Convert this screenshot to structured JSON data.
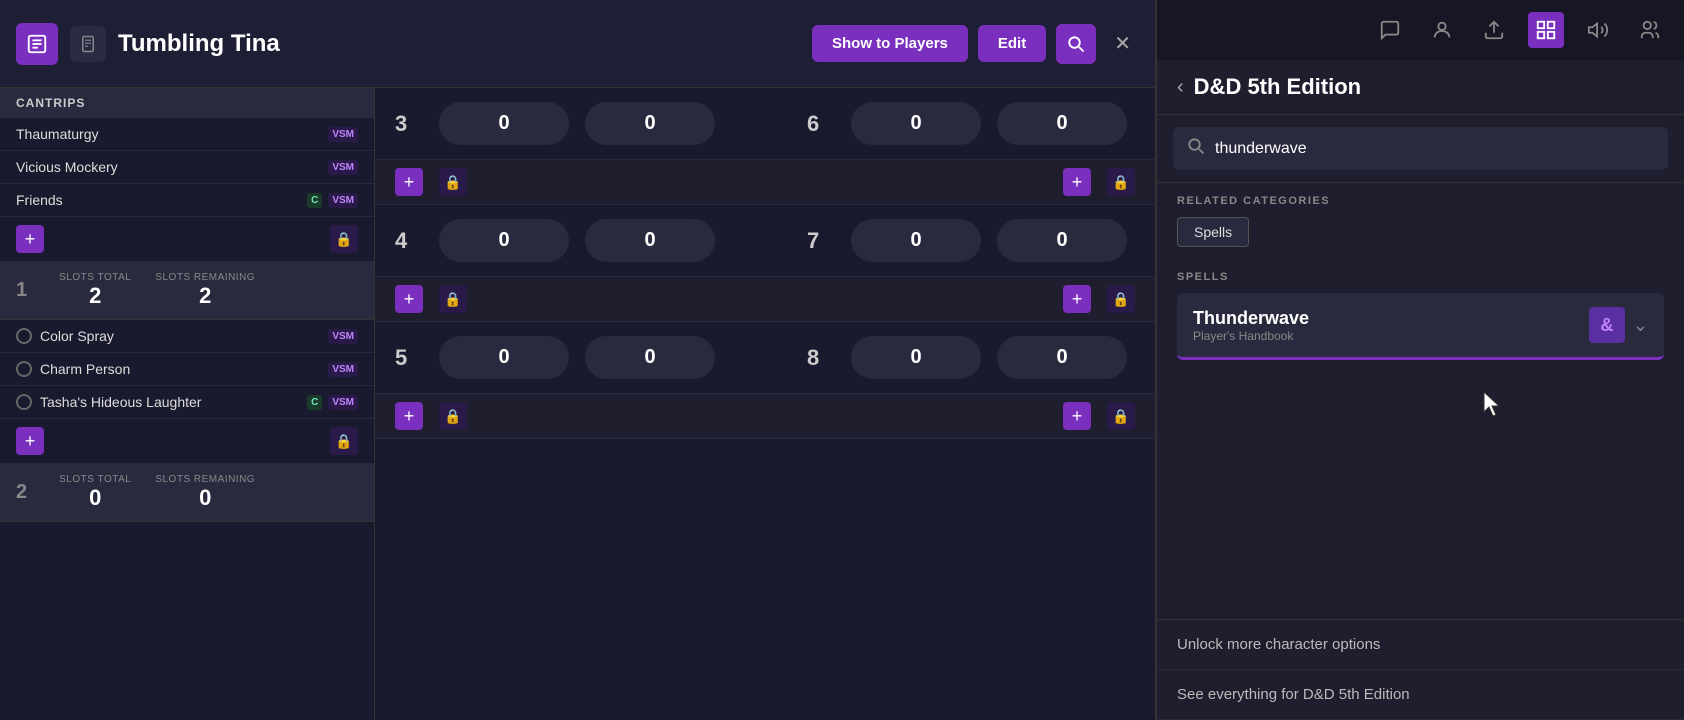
{
  "header": {
    "title": "Tumbling Tina",
    "show_players_label": "Show to Players",
    "edit_label": "Edit"
  },
  "spell_list": {
    "cantrips_label": "CANTRIPS",
    "spells": [
      {
        "name": "Thaumaturgy",
        "tags": [
          "VSM"
        ],
        "has_circle": false
      },
      {
        "name": "Vicious Mockery",
        "tags": [
          "VSM"
        ],
        "has_circle": false
      },
      {
        "name": "Friends",
        "tags": [
          "C",
          "VSM"
        ],
        "has_circle": false
      }
    ],
    "level1_spells": [
      {
        "name": "Color Spray",
        "tags": [
          "VSM"
        ],
        "has_circle": true
      },
      {
        "name": "Charm Person",
        "tags": [
          "VSM"
        ],
        "has_circle": true
      },
      {
        "name": "Tasha's Hideous Laughter",
        "tags": [
          "C",
          "VSM"
        ],
        "has_circle": true
      }
    ],
    "slots_total_label": "SLOTS TOTAL",
    "slots_remaining_label": "SLOTS REMAINING",
    "level1": {
      "num": "1",
      "slots_total": "2",
      "slots_remaining": "2"
    },
    "level2": {
      "num": "2",
      "slots_total": "0",
      "slots_remaining": "0"
    }
  },
  "spell_grid": {
    "rows": [
      {
        "level": "3",
        "val1": "0",
        "val2": "0",
        "level2": "6",
        "val3": "0",
        "val4": "0"
      },
      {
        "level": "4",
        "val1": "0",
        "val2": "0",
        "level2": "7",
        "val3": "0",
        "val4": "0"
      },
      {
        "level": "5",
        "val1": "0",
        "val2": "0",
        "level2": "8",
        "val3": "0",
        "val4": "0"
      }
    ]
  },
  "sidebar": {
    "title": "D&D 5th Edition",
    "back_label": "‹",
    "search_placeholder": "thunderwave",
    "search_value": "thunderwave",
    "related_categories_label": "RELATED CATEGORIES",
    "spells_category_label": "Spells",
    "spells_section_label": "SPELLS",
    "spell_result": {
      "name": "Thunderwave",
      "source": "Player's Handbook"
    },
    "bottom_options": [
      "Unlock more character options",
      "See everything for D&D 5th Edition"
    ],
    "nav_icons": [
      "chat",
      "person",
      "upload",
      "grid",
      "volume",
      "people"
    ]
  }
}
